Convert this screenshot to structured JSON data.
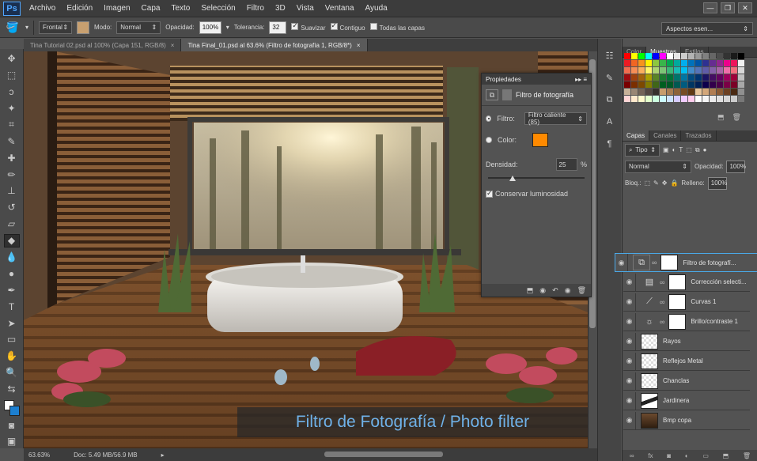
{
  "menubar": {
    "logo": "Ps",
    "items": [
      "Archivo",
      "Edición",
      "Imagen",
      "Capa",
      "Texto",
      "Selección",
      "Filtro",
      "3D",
      "Vista",
      "Ventana",
      "Ayuda"
    ]
  },
  "options": {
    "preset": "Frontal",
    "mode_label": "Modo:",
    "mode_value": "Normal",
    "opacity_label": "Opacidad:",
    "opacity_value": "100%",
    "tolerance_label": "Tolerancia:",
    "tolerance_value": "32",
    "smooth_label": "Suavizar",
    "contiguous_label": "Contiguo",
    "all_layers_label": "Todas las capas",
    "workspace": "Aspectos esen..."
  },
  "tabs": [
    {
      "label": "Tina Tutorial 02.psd al 100% (Capa 151, RGB/8)"
    },
    {
      "label": "Tina Final_01.psd al 63.6% (Filtro de fotografía 1, RGB/8*)"
    }
  ],
  "status": {
    "zoom": "63.63%",
    "doc": "Doc: 5.49 MB/56.9 MB"
  },
  "properties": {
    "title": "Propiedades",
    "heading": "Filtro de fotografía",
    "filter_label": "Filtro:",
    "filter_value": "Filtro caliente (85)",
    "color_label": "Color:",
    "density_label": "Densidad:",
    "density_value": "25",
    "density_unit": "%",
    "density_fraction": 0.25,
    "preserve_label": "Conservar luminosidad",
    "color_swatch": "#ff8a00"
  },
  "swatches_panel": {
    "tabs": [
      "Color",
      "Muestras",
      "Estilos"
    ]
  },
  "layers_panel": {
    "tabs": [
      "Capas",
      "Canales",
      "Trazados"
    ],
    "kind": "Tipo",
    "blend": "Normal",
    "opacity_label": "Opacidad:",
    "opacity_value": "100%",
    "lock_label": "Bloq.:",
    "fill_label": "Relleno:",
    "fill_value": "100%",
    "layers": [
      {
        "name": "Filtro de fotografí...",
        "type": "adjustment",
        "icon": "photo-filter-icon"
      },
      {
        "name": "Corrección selecti...",
        "type": "adjustment",
        "icon": "selective-color-icon"
      },
      {
        "name": "Curvas 1",
        "type": "adjustment",
        "icon": "curves-icon"
      },
      {
        "name": "Brillo/contraste 1",
        "type": "adjustment",
        "icon": "brightness-icon"
      },
      {
        "name": "Rayos",
        "type": "pixel"
      },
      {
        "name": "Reflejos Metal",
        "type": "pixel"
      },
      {
        "name": "Chanclas",
        "type": "pixel"
      },
      {
        "name": "Jardinera",
        "type": "pixel"
      },
      {
        "name": "Bmp copa",
        "type": "pixel"
      }
    ]
  },
  "caption": "Filtro de Fotografía / Photo filter",
  "colors": {
    "accent": "#4aa9e8",
    "caption": "#6fb1e8"
  }
}
